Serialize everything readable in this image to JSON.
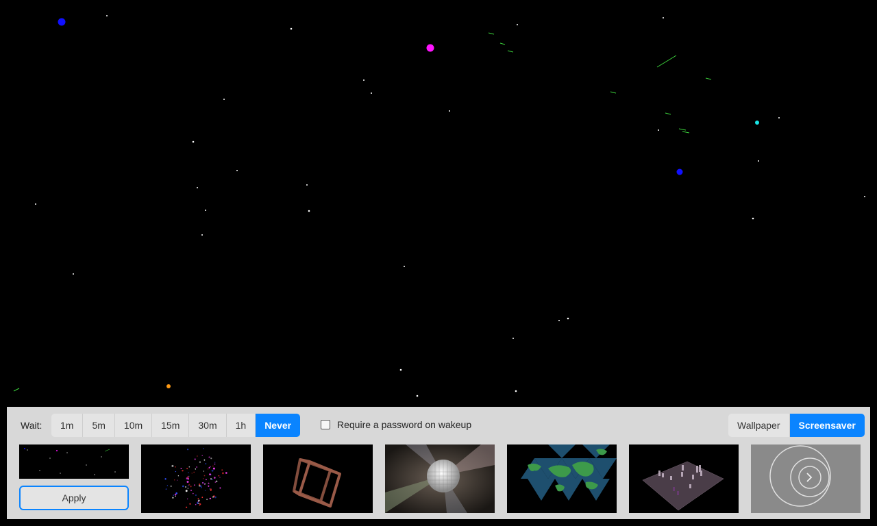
{
  "wait": {
    "label": "Wait:",
    "options": [
      "1m",
      "5m",
      "10m",
      "15m",
      "30m",
      "1h",
      "Never"
    ],
    "selected": "Never"
  },
  "password": {
    "label": "Require a password on wakeup",
    "checked": false
  },
  "mode": {
    "options": [
      "Wallpaper",
      "Screensaver"
    ],
    "selected": "Screensaver"
  },
  "apply_label": "Apply",
  "colors": {
    "accent": "#0a84ff",
    "panel_bg": "#d8d8d8"
  },
  "thumbnails": [
    {
      "name": "particles"
    },
    {
      "name": "hypercube"
    },
    {
      "name": "disco-ball"
    },
    {
      "name": "flat-earth-map"
    },
    {
      "name": "chess-board"
    },
    {
      "name": "rings",
      "action_icon": "chevron-right-icon"
    }
  ]
}
